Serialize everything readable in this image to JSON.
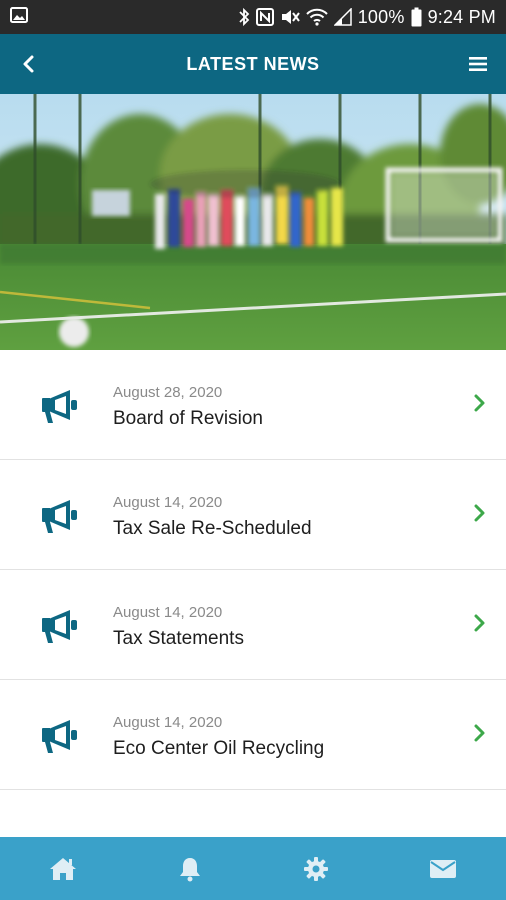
{
  "status_bar": {
    "battery": "100%",
    "time": "9:24 PM",
    "icons": [
      "image-icon",
      "bluetooth-icon",
      "nfc-icon",
      "mute-icon",
      "wifi-icon",
      "signal-icon"
    ]
  },
  "header": {
    "title": "LATEST NEWS",
    "back_icon": "chevron-left-icon",
    "menu_icon": "hamburger-menu-icon",
    "color": "#0d6782"
  },
  "hero": {
    "description_icon": "soccer-field-photo"
  },
  "news": {
    "icon": "megaphone-icon",
    "items": [
      {
        "date": "August 28, 2020",
        "title": "Board of Revision"
      },
      {
        "date": "August 14, 2020",
        "title": "Tax Sale Re-Scheduled"
      },
      {
        "date": "August 14, 2020",
        "title": "Tax Statements"
      },
      {
        "date": "August 14, 2020",
        "title": "Eco Center Oil Recycling"
      }
    ],
    "accent_color": "#0d6782",
    "chevron_color": "#3da84a"
  },
  "bottom_nav": {
    "color": "#3aa1c9",
    "items": [
      {
        "icon": "home-icon"
      },
      {
        "icon": "bell-icon"
      },
      {
        "icon": "gear-icon"
      },
      {
        "icon": "mail-icon"
      }
    ]
  }
}
